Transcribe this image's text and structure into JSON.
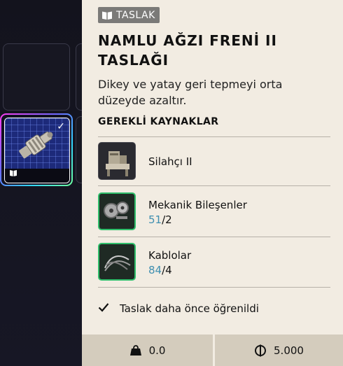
{
  "inventory": {
    "selected_slot_checked": true
  },
  "blueprint": {
    "tag_label": "TASLAK",
    "title_line1": "NAMLU AĞZI FRENİ II",
    "title_line2": "TASLAĞI",
    "description": "Dikey ve yatay geri tepmeyi orta düzeyde azaltır.",
    "requirements_heading": "GEREKLİ KAYNAKLAR",
    "requirements": [
      {
        "name": "Silahçı II",
        "icon": "workbench-icon"
      },
      {
        "name": "Mekanik Bileşenler",
        "have": "51",
        "need": "/2",
        "icon": "gears-icon"
      },
      {
        "name": "Kablolar",
        "have": "84",
        "need": "/4",
        "icon": "cables-icon"
      }
    ],
    "learned_text": "Taslak daha önce öğrenildi"
  },
  "footer": {
    "weight": "0.0",
    "price": "5.000"
  },
  "colors": {
    "panel_bg": "#f2ece2",
    "quantity_have": "#3f8fb0",
    "owned_border": "#2fbf6b"
  }
}
